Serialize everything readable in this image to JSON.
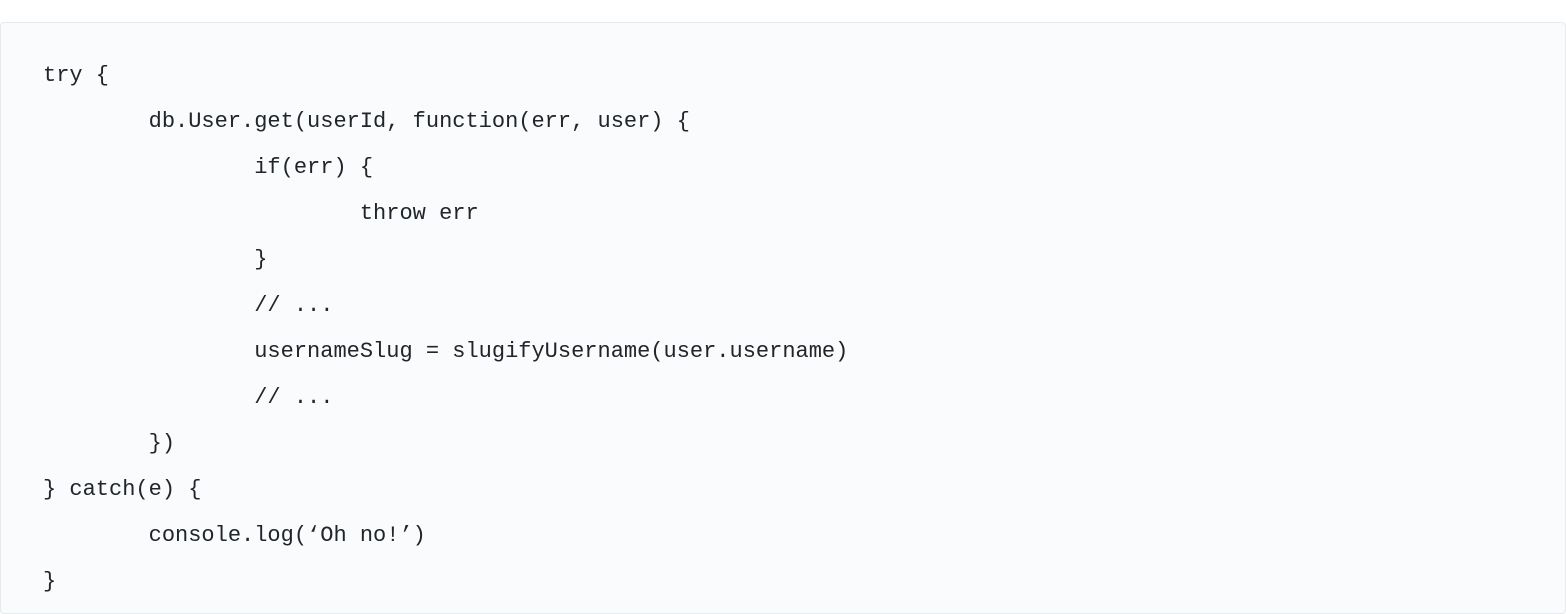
{
  "code": {
    "lines": [
      "try {",
      "        db.User.get(userId, function(err, user) {",
      "                if(err) {",
      "                        throw err",
      "                }",
      "                // ...",
      "                usernameSlug = slugifyUsername(user.username)",
      "                // ...",
      "        })",
      "} catch(e) {",
      "        console.log(‘Oh no!’)",
      "}"
    ]
  }
}
